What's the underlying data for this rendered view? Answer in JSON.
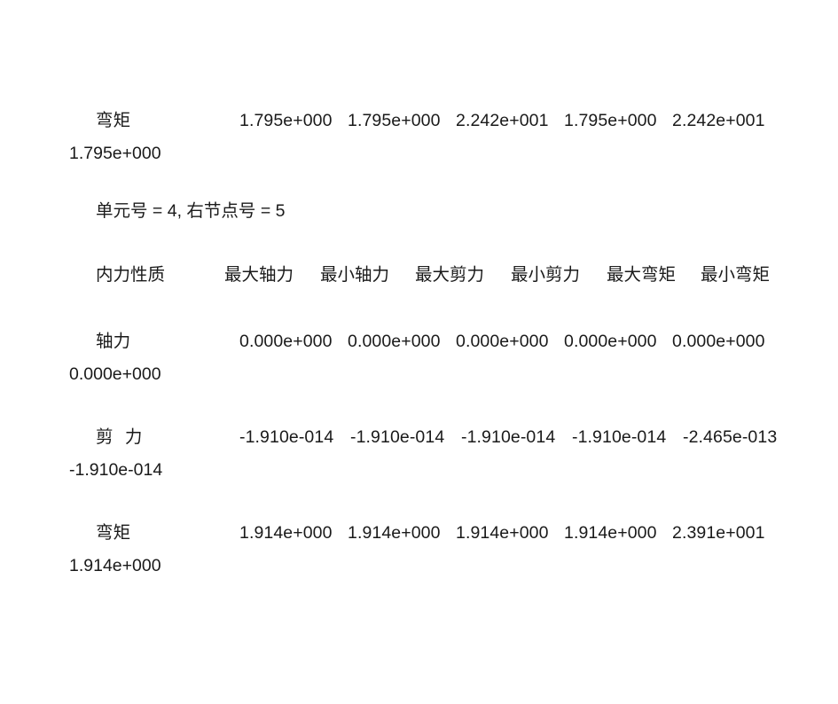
{
  "document": {
    "language": "zh-CN",
    "background_color": "#ffffff",
    "text_color": "#1a1a1a"
  },
  "block_previous": {
    "row_label": "弯矩",
    "values": [
      "1.795e+000",
      "1.795e+000",
      "2.242e+001",
      "1.795e+000",
      "2.242e+001"
    ],
    "wrapped_value": "1.795e+000"
  },
  "element_info": {
    "text": "单元号 = 4, 右节点号 = 5",
    "element_number": "4",
    "right_node_number": "5"
  },
  "table": {
    "headers": [
      "内力性质",
      "最大轴力",
      "最小轴力",
      "最大剪力",
      "最小剪力",
      "最大弯矩",
      "最小弯矩"
    ],
    "rows": [
      {
        "label": "轴力",
        "label_spaced": false,
        "values": [
          "0.000e+000",
          "0.000e+000",
          "0.000e+000",
          "0.000e+000",
          "0.000e+000"
        ],
        "wrapped_value": "0.000e+000"
      },
      {
        "label": "剪 力",
        "label_spaced": true,
        "values": [
          "-1.910e-014",
          "-1.910e-014",
          "-1.910e-014",
          "-1.910e-014",
          "-2.465e-013"
        ],
        "wrapped_value": "-1.910e-014"
      },
      {
        "label": "弯矩",
        "label_spaced": false,
        "values": [
          "1.914e+000",
          "1.914e+000",
          "1.914e+000",
          "1.914e+000",
          "2.391e+001"
        ],
        "wrapped_value": "1.914e+000"
      }
    ]
  },
  "chart_data": {
    "type": "table",
    "title": "单元号 = 4, 右节点号 = 5",
    "columns": [
      "内力性质",
      "最大轴力",
      "最小轴力",
      "最大剪力",
      "最小剪力",
      "最大弯矩",
      "最小弯矩"
    ],
    "rows": [
      [
        "轴力",
        "0.000e+000",
        "0.000e+000",
        "0.000e+000",
        "0.000e+000",
        "0.000e+000",
        "0.000e+000"
      ],
      [
        "剪 力",
        "-1.910e-014",
        "-1.910e-014",
        "-1.910e-014",
        "-1.910e-014",
        "-2.465e-013",
        "-1.910e-014"
      ],
      [
        "弯矩",
        "1.914e+000",
        "1.914e+000",
        "1.914e+000",
        "1.914e+000",
        "2.391e+001",
        "1.914e+000"
      ]
    ],
    "preceding_partial_row": [
      "弯矩",
      "1.795e+000",
      "1.795e+000",
      "2.242e+001",
      "1.795e+000",
      "2.242e+001",
      "1.795e+000"
    ]
  }
}
